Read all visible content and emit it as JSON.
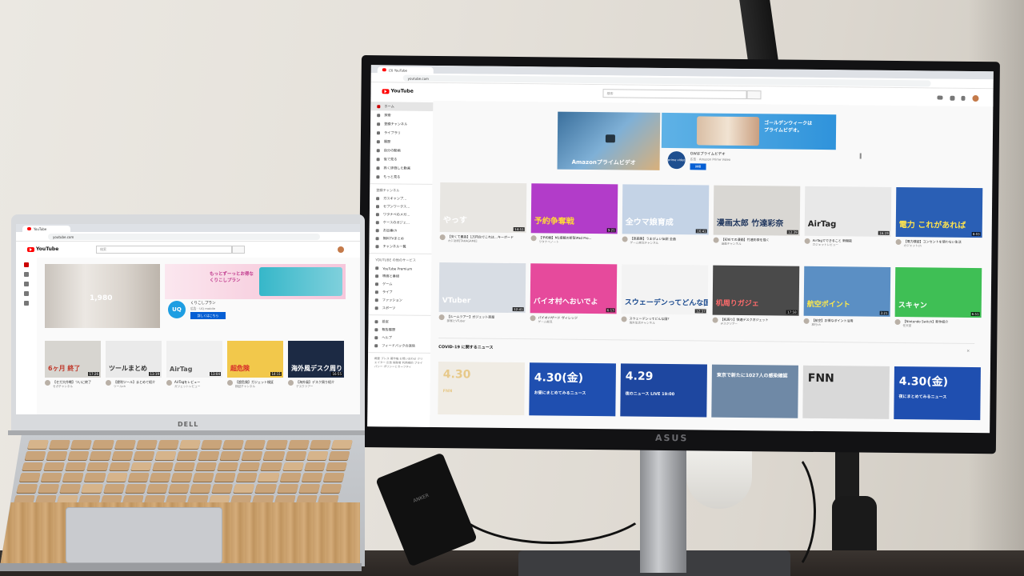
{
  "scene": {
    "monitor_brand": "ASUS",
    "laptop_brand": "DELL",
    "charger_label": "ANKER"
  },
  "monitor": {
    "browser": {
      "tab_title": "(3) YouTube",
      "url": "youtube.com"
    },
    "youtube": {
      "logo_text": "YouTube",
      "country_code": "JP",
      "search_placeholder": "検索",
      "sidebar": {
        "items": [
          {
            "label": "ホーム",
            "active": true
          },
          {
            "label": "探索",
            "active": false
          },
          {
            "label": "登録チャンネル",
            "active": false
          },
          {
            "label": "ライブラリ",
            "active": false
          },
          {
            "label": "履歴",
            "active": false
          },
          {
            "label": "自分の動画",
            "active": false
          },
          {
            "label": "後で見る",
            "active": false
          },
          {
            "label": "高く評価した動画",
            "active": false
          },
          {
            "label": "もっと見る",
            "active": false
          }
        ],
        "channels_header": "登録チャンネル",
        "channels": [
          {
            "label": "ガスキャンプ…"
          },
          {
            "label": "セブンワークス…"
          },
          {
            "label": "ワタナベのメガ…"
          },
          {
            "label": "ケースのガジェ…"
          },
          {
            "label": "お出番ch"
          },
          {
            "label": "無料TVまとめ"
          },
          {
            "label": "チャンネル一覧"
          }
        ],
        "more_header": "YOUTUBE の他のサービス",
        "more": [
          {
            "label": "YouTube Premium"
          },
          {
            "label": "映画と番組"
          },
          {
            "label": "ゲーム"
          },
          {
            "label": "ライブ"
          },
          {
            "label": "ファッション"
          },
          {
            "label": "スポーツ"
          }
        ],
        "settings": [
          {
            "label": "設定"
          },
          {
            "label": "報告履歴"
          },
          {
            "label": "ヘルプ"
          },
          {
            "label": "フィードバックの送信"
          }
        ],
        "footer": "概要 プレス 著作権 お問い合わせ クリエイター 広告 開発者 利用規約 プライバシー ポリシーとセーフティ"
      },
      "ad": {
        "thumb_caption": "Amazonプライムビデオ",
        "panel_text": "ゴールデンウィークは\nプライムビデオ。",
        "badge_text": "prime video",
        "title": "GWはプライムビデオ",
        "meta": "広告 · Amazon Prime Video",
        "button": "詳細"
      },
      "row1": [
        {
          "thumb_text": "やっす",
          "duration": "14:51",
          "title": "【安くて最高】1万円台でこれは…キーボード",
          "meta": "カジ次郎[TAKAGAME]",
          "bg": "#e8e6e2",
          "fg": "#ffffff"
        },
        {
          "thumb_text": "予約争奪戦",
          "duration": "9:21",
          "title": "【予約戦】M1搭載の新型iPad Pro…",
          "meta": "ワタナベノート",
          "bg": "#b23cc9",
          "fg": "#ffd83a"
        },
        {
          "thumb_text": "全ウマ娘育成",
          "duration": "16:41",
          "title": "【高画質】うまぴょい伝説 全曲",
          "meta": "ゲーム実況チャンネル",
          "bg": "#c4d3e6",
          "fg": "#ffffff"
        },
        {
          "thumb_text": "漫画太郎 竹達彩奈",
          "duration": "12:39",
          "title": "【初めての漫画】竹達彩奈を描く",
          "meta": "漫画チャンネル",
          "bg": "#d9d7d3",
          "fg": "#22385f"
        },
        {
          "thumb_text": "AirTag",
          "duration": "16:19",
          "title": "AirTagでできること 新機能",
          "meta": "ガジェットレビュー",
          "bg": "#e8e8e8",
          "fg": "#222222"
        },
        {
          "thumb_text": "電力 これがあれば",
          "duration": "8:03",
          "title": "【電力検証】コンセントを使わない生活",
          "meta": "ガジェットch",
          "bg": "#2a5fb5",
          "fg": "#ffe44d"
        }
      ],
      "row2": [
        {
          "thumb_text": "VTuber",
          "duration": "12:41",
          "title": "【ルームツアー】ガジェット部屋",
          "meta": "部屋とVTuber",
          "bg": "#d8dde4",
          "fg": "#ffffff"
        },
        {
          "thumb_text": "バイオ村へおいでよ",
          "duration": "6:13",
          "title": "バイオハザード ヴィレッジ",
          "meta": "ゲーム実況",
          "bg": "#e64a9c",
          "fg": "#ffffff"
        },
        {
          "thumb_text": "スウェーデンってどんな国？",
          "duration": "12:37",
          "title": "スウェーデンってどんな国？",
          "meta": "海外生活チャンネル",
          "bg": "#f3f3f3",
          "fg": "#1c4b8f"
        },
        {
          "thumb_text": "机周りガジェ",
          "duration": "17:58",
          "title": "【机周り】快適デスクガジェット",
          "meta": "デスクツアー",
          "bg": "#4a4a4a",
          "fg": "#ff6b6b"
        },
        {
          "thumb_text": "航空ポイント",
          "duration": "3:21",
          "title": "【航空】お得なポイント活用",
          "meta": "旅行ch",
          "bg": "#5b8fc4",
          "fg": "#ffe94a"
        },
        {
          "thumb_text": "スキャン",
          "duration": "6:51",
          "title": "【Nintendo Switch】新作紹介",
          "meta": "任天堂",
          "bg": "#3fbf55",
          "fg": "#ffffff"
        }
      ],
      "section_title": "COVID-19 に関するニュース",
      "news": [
        {
          "thumb_text": "4.30",
          "sub": "FNN",
          "bg": "#f0ece4",
          "fg": "#e7c98a"
        },
        {
          "thumb_text": "4.30(金)",
          "sub": "お昼にまとめてみるニュース",
          "bg": "#1f4fb0",
          "fg": "#ffffff"
        },
        {
          "thumb_text": "4.29",
          "sub": "夜のニュース LIVE 19:00",
          "bg": "#1e47a0",
          "fg": "#ffffff"
        },
        {
          "thumb_text": "東京で新たに1027人の感染確認",
          "sub": "",
          "bg": "#6f89a6",
          "fg": "#ffffff"
        },
        {
          "thumb_text": "FNN",
          "sub": "",
          "bg": "#d9d9d9",
          "fg": "#222222"
        },
        {
          "thumb_text": "4.30(金)",
          "sub": "夜にまとめてみるニュース",
          "bg": "#1f4fb0",
          "fg": "#ffffff"
        }
      ]
    }
  },
  "laptop": {
    "browser": {
      "tab_title": "YouTube",
      "url": "youtube.com"
    },
    "youtube": {
      "logo_text": "YouTube",
      "search_placeholder": "検索",
      "ad": {
        "thumb_time": "1,980",
        "panel_text": "もっとずーっとお得な\nくりこしプラン",
        "title": "くりこしプラン",
        "meta": "広告 · UQ mobile",
        "button": "詳しくはこちら",
        "logo": "UQ"
      },
      "row": [
        {
          "thumb_text": "6ヶ月 終了",
          "duration": "17:26",
          "title": "【セガ大作戦】ついに終了",
          "meta": "セガチャンネル",
          "bg": "#d7d5d0",
          "fg": "#c0392b"
        },
        {
          "thumb_text": "ツールまとめ",
          "duration": "13:19",
          "title": "【便利ツール】まとめて紹介",
          "meta": "ツールch",
          "bg": "#eaeaea",
          "fg": "#333333"
        },
        {
          "thumb_text": "AirTag",
          "duration": "13:04",
          "title": "AirTagをレビュー",
          "meta": "ガジェットレビュー",
          "bg": "#f0f0f0",
          "fg": "#555555"
        },
        {
          "thumb_text": "超危険",
          "duration": "14:11",
          "title": "【超危険】ガジェット検証",
          "meta": "検証チャンネル",
          "bg": "#f2c84b",
          "fg": "#d62828"
        },
        {
          "thumb_text": "海外風デスク周り",
          "duration": "16:55",
          "title": "【海外風】デスク周り紹介",
          "meta": "デスクツアー",
          "bg": "#1c2a44",
          "fg": "#ffffff"
        }
      ]
    }
  }
}
